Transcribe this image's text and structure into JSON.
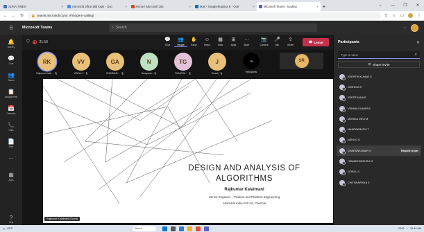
{
  "browser": {
    "tabs": [
      {
        "title": "SONA TIMES",
        "color": "#4a6fb5",
        "active": false
      },
      {
        "title": "microsoft office 365 login - Goo",
        "color": "#4a8af4",
        "active": false
      },
      {
        "title": "Home | Microsoft 365",
        "color": "#d24726",
        "active": false
      },
      {
        "title": "Mail - Sangeethapriya K - Outl",
        "color": "#0f6cbd",
        "active": false
      },
      {
        "title": "Microsoft Teams - loading",
        "color": "#5b5fc7",
        "active": true
      }
    ],
    "url": "teams.microsoft.com/_#/modern-calling/"
  },
  "teams": {
    "app_title": "Microsoft Teams",
    "search_placeholder": "Search",
    "user_initials": ""
  },
  "rail": [
    {
      "icon": "bell-icon",
      "glyph": "🔔",
      "label": "Activity"
    },
    {
      "icon": "chat-icon",
      "glyph": "💬",
      "label": "Chat"
    },
    {
      "icon": "teams-icon",
      "glyph": "👥",
      "label": "Teams"
    },
    {
      "icon": "assignments-icon",
      "glyph": "📋",
      "label": "Assignments"
    },
    {
      "icon": "calendar-icon",
      "glyph": "📅",
      "label": "Calendar"
    },
    {
      "icon": "calls-icon",
      "glyph": "📞",
      "label": "Calls"
    },
    {
      "icon": "files-icon",
      "glyph": "📄",
      "label": "Files"
    },
    {
      "icon": "more-icon",
      "glyph": "···",
      "label": ""
    },
    {
      "icon": "apps-icon",
      "glyph": "▦",
      "label": "Apps"
    }
  ],
  "rail_bottom": {
    "label": "Help"
  },
  "meeting": {
    "timer": "21:16",
    "toolbar": [
      {
        "icon": "chat-icon",
        "glyph": "💬",
        "label": "Chat",
        "active": false
      },
      {
        "icon": "people-icon",
        "glyph": "👥",
        "label": "People",
        "active": true
      },
      {
        "icon": "raise-hand-icon",
        "glyph": "✋",
        "label": "Raise",
        "active": false
      },
      {
        "icon": "react-icon",
        "glyph": "☺",
        "label": "React",
        "active": false
      },
      {
        "icon": "view-icon",
        "glyph": "▦",
        "label": "View",
        "active": false
      },
      {
        "icon": "apps-icon",
        "glyph": "⊞",
        "label": "Apps",
        "active": false
      },
      {
        "icon": "more-icon",
        "glyph": "···",
        "label": "More",
        "active": false
      },
      {
        "icon": "camera-icon",
        "glyph": "📷",
        "label": "Camera",
        "active": false
      },
      {
        "icon": "mic-icon",
        "glyph": "🎤",
        "label": "Mic",
        "active": false
      },
      {
        "icon": "share-icon",
        "glyph": "⇪",
        "label": "Share",
        "active": false
      }
    ],
    "leave_label": "Leave",
    "participants_row": [
      {
        "initials": "RK",
        "name": "Rajkumar Kalai...",
        "color": "#e8c07a",
        "active": true
      },
      {
        "initials": "VV",
        "name": "VISHAL V",
        "color": "#e8c07a",
        "active": false
      },
      {
        "initials": "GA",
        "name": "GOWRANA...",
        "color": "#e8c07a",
        "active": false
      },
      {
        "initials": "N",
        "name": "Narayanan",
        "color": "#bfe0c0",
        "active": false
      },
      {
        "initials": "TG",
        "name": "THAARINI...",
        "color": "#e3c2d8",
        "active": false
      },
      {
        "initials": "J",
        "name": "Saranij",
        "color": "#e8c07a",
        "active": false
      }
    ],
    "participant_count": "78",
    "participant_count_label": "Participants",
    "sr_initials": "SR",
    "mic_off_glyph": "🎙",
    "slide": {
      "title_line1": "DESIGN AND ANALYSIS OF",
      "title_line2": "ALGORITHMS",
      "author": "Rajkumar Kalaimani",
      "role": "Senior Engineer – Product and Platform Engineering",
      "company": "Altimetrik India Pvt Ltd, Chennai",
      "presenter_tag": "Rajkumar Kalaimani (Guest)"
    }
  },
  "panel": {
    "title": "Participants",
    "search_placeholder": "Type a name",
    "share_invite": "Share invite",
    "people": [
      {
        "name": "KEERTHI KUMAR S",
        "request": ""
      },
      {
        "name": "JOSHIGA S",
        "request": ""
      },
      {
        "name": "KEERTHANA R",
        "request": ""
      },
      {
        "name": "VISHNU KUMAR B",
        "request": ""
      },
      {
        "name": "MONICA DEVI M",
        "request": ""
      },
      {
        "name": "MANOBARATHI T",
        "request": ""
      },
      {
        "name": "NEHA D G",
        "request": ""
      },
      {
        "name": "DHARUNKUMAR V",
        "request": "Request to join"
      },
      {
        "name": "HEMADHARSHINI M",
        "request": ""
      },
      {
        "name": "GOKUL S",
        "request": ""
      },
      {
        "name": "CHITHRAPRIYA S",
        "request": ""
      }
    ]
  },
  "taskbar": {
    "weather": "82°F",
    "search": "Search",
    "lang": "ENG",
    "time": "10:44 AM"
  }
}
